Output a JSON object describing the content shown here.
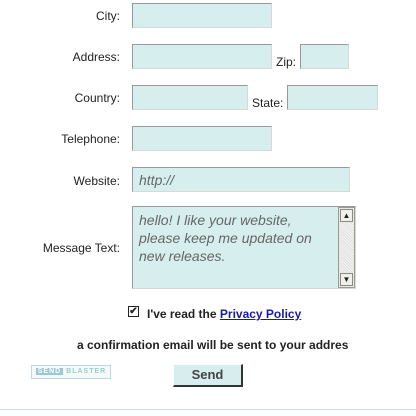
{
  "form": {
    "city_label": "City:",
    "address_label": "Address:",
    "zip_label": "Zip:",
    "country_label": "Country:",
    "state_label": "State:",
    "telephone_label": "Telephone:",
    "website_label": "Website:",
    "website_placeholder": "http://",
    "message_label": "Message Text:",
    "message_placeholder": "hello! I like your website, please keep me updated on new releases.",
    "consent_prefix": "I've read the ",
    "privacy_link": "Privacy Policy",
    "confirmation_text": "a confirmation email will be sent to your addres",
    "send_label": "Send",
    "logo_text_accent": "SEND",
    "logo_text": "BLASTER",
    "scroll_up": "▲",
    "scroll_down": "▼",
    "checkmark": "✔"
  },
  "colors": {
    "field_bg": "#d6eeee",
    "link": "#1a1aa8"
  }
}
